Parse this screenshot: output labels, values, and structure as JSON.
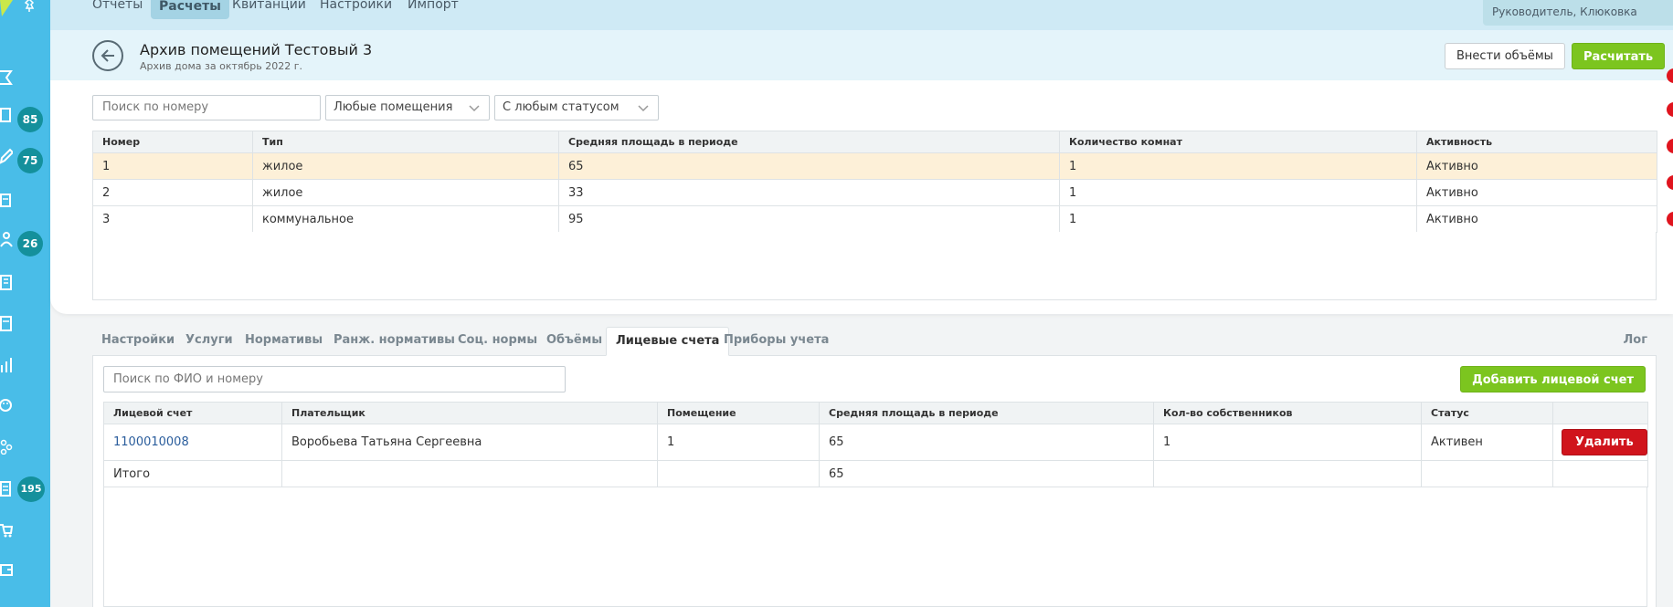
{
  "sidebar": {
    "badges": [
      "85",
      "75",
      "26",
      "195"
    ]
  },
  "topnav": {
    "items": [
      "Отчеты",
      "Расчеты",
      "Квитанции",
      "Настройки",
      "Импорт"
    ],
    "active": "Расчеты",
    "user_role": "Руководитель, Клюковка"
  },
  "header": {
    "title": "Архив помещений Тестовый 3",
    "subtitle": "Архив дома за октябрь 2022 г.",
    "volumes_button": "Внести объёмы",
    "calculate_button": "Расчитать"
  },
  "filters": {
    "search_placeholder": "Поиск по номеру",
    "premises_select": "Любые помещения",
    "status_select": "С любым статусом"
  },
  "premises_table": {
    "columns": [
      "Номер",
      "Тип",
      "Средняя площадь в периоде",
      "Количество комнат",
      "Активность"
    ],
    "rows": [
      [
        "1",
        "жилое",
        "65",
        "1",
        "Активно"
      ],
      [
        "2",
        "жилое",
        "33",
        "1",
        "Активно"
      ],
      [
        "3",
        "коммунальное",
        "95",
        "1",
        "Активно"
      ]
    ]
  },
  "tabs": {
    "items": [
      "Настройки",
      "Услуги",
      "Нормативы",
      "Ранж. нормативы",
      "Соц. нормы",
      "Объёмы",
      "Лицевые счета",
      "Приборы учета"
    ],
    "active": "Лицевые счета",
    "log": "Лог"
  },
  "accounts": {
    "search_placeholder": "Поиск по ФИО и номеру",
    "add_button": "Добавить лицевой счет",
    "columns": [
      "Лицевой счет",
      "Плательщик",
      "Помещение",
      "Средняя площадь в периоде",
      "Кол-во собственников",
      "Статус",
      ""
    ],
    "rows": [
      {
        "account": "1100010008",
        "payer": "Воробьева Татьяна Сергеевна",
        "premise": "1",
        "area": "65",
        "owners": "1",
        "status": "Активен",
        "action": "Удалить"
      }
    ],
    "total": {
      "label": "Итого",
      "area": "65"
    }
  },
  "colors": {
    "sidebar": "#49bde8",
    "accent_green": "#7cc51f",
    "danger_red": "#d0141c",
    "badge": "#14909c",
    "row_highlight": "#fdf0d8"
  }
}
